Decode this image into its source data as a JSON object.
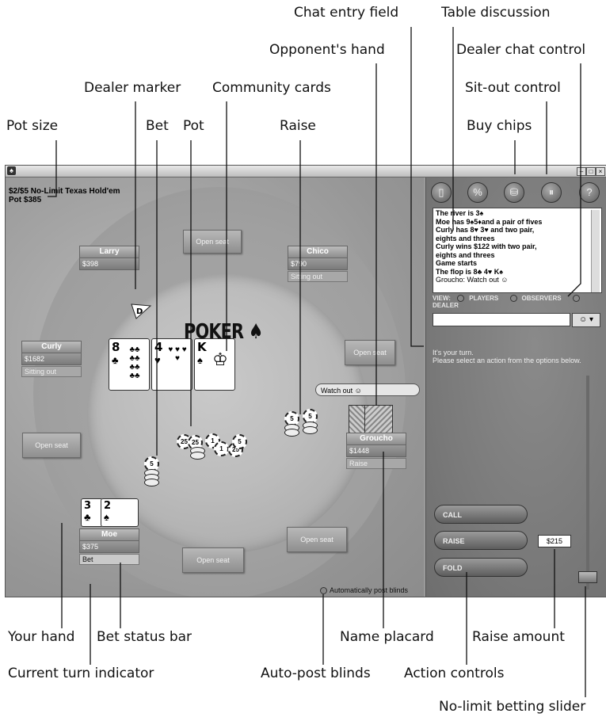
{
  "callouts": {
    "chat_entry_field": "Chat entry field",
    "table_discussion": "Table discussion",
    "opponents_hand": "Opponent's hand",
    "dealer_chat_control": "Dealer chat control",
    "dealer_marker": "Dealer marker",
    "community_cards": "Community cards",
    "sit_out_control": "Sit-out control",
    "pot_size": "Pot size",
    "bet": "Bet",
    "pot": "Pot",
    "raise": "Raise",
    "buy_chips": "Buy chips",
    "your_hand": "Your hand",
    "bet_status_bar": "Bet status bar",
    "name_placard": "Name placard",
    "raise_amount": "Raise amount",
    "current_turn_indicator": "Current turn indicator",
    "auto_post_blinds": "Auto-post blinds",
    "action_controls": "Action controls",
    "no_limit_betting_slider": "No-limit betting slider"
  },
  "game": {
    "title": "$2/$5 No-Limit Texas Hold'em",
    "pot": "Pot $385"
  },
  "seats": {
    "open_label": "Open seat"
  },
  "players": {
    "larry": {
      "name": "Larry",
      "chips": "$398"
    },
    "chico": {
      "name": "Chico",
      "chips": "$790",
      "status": "Sitting out"
    },
    "curly": {
      "name": "Curly",
      "chips": "$1682",
      "status": "Sitting out"
    },
    "groucho": {
      "name": "Groucho",
      "chips": "$1448",
      "status": "Raise"
    },
    "moe": {
      "name": "Moe",
      "chips": "$375",
      "status": "Bet"
    }
  },
  "dealer_button": "D",
  "logo_text": "POKER",
  "community_cards": [
    {
      "rank": "8",
      "suit": "♣",
      "pips": "♣♣ ♣♣ ♣♣ ♣♣"
    },
    {
      "rank": "4",
      "suit": "♥",
      "pips": "♥ ♥ ♥ ♥"
    },
    {
      "rank": "K",
      "suit": "♠",
      "pips": "♔"
    }
  ],
  "my_hand": [
    {
      "rank": "3",
      "suit": "♣"
    },
    {
      "rank": "2",
      "suit": "♠"
    }
  ],
  "chips": {
    "bet": "5",
    "raise_a": "5",
    "raise_b": "5",
    "pot": [
      "25",
      "25",
      "1",
      "1",
      "25",
      "5"
    ]
  },
  "bubble_text": "Watch out ☺",
  "autopost_label": "Automatically post blinds",
  "sidebar": {
    "icons": [
      "▯",
      "%",
      "⛁",
      "⏸",
      "?"
    ],
    "chat_lines": [
      {
        "text": "The river is 3♠",
        "bold": true
      },
      {
        "text": "Moe has 9♠5♦and a pair of fives",
        "bold": true
      },
      {
        "text": "Curly has 8♥ 3♥ and two pair,",
        "bold": true
      },
      {
        "text": "eights and threes",
        "bold": true
      },
      {
        "text": "Curly wins $122 with two pair,",
        "bold": true
      },
      {
        "text": "eights and threes",
        "bold": true
      },
      {
        "text": "Game starts",
        "bold": true
      },
      {
        "text": "The flop is 8♣ 4♥ K♠",
        "bold": true
      },
      {
        "text": "Groucho: Watch out ☺",
        "bold": false
      }
    ],
    "view_label": "VIEW:",
    "view_players": "PLAYERS",
    "view_observers": "OBSERVERS",
    "view_dealer": "DEALER",
    "emote": "☺ ▾",
    "turn_line1": "It's your turn.",
    "turn_line2": "Please select an action from the options below.",
    "call": "CALL",
    "raise": "RAISE",
    "fold": "FOLD",
    "raise_amount": "$215"
  }
}
